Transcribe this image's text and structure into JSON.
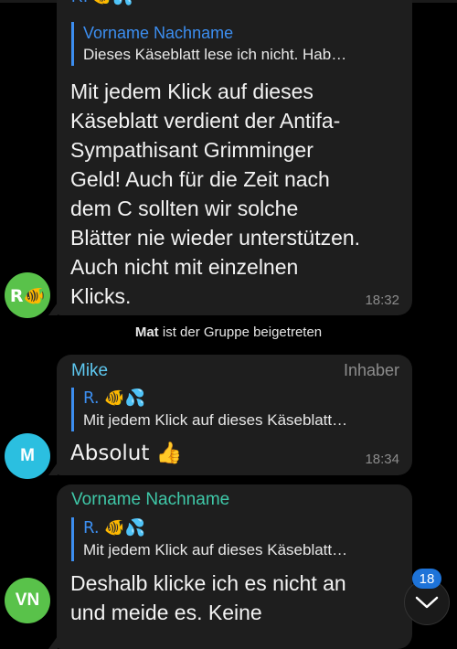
{
  "messages": [
    {
      "reply_name": "Vorname Nachname",
      "reply_text": "Dieses Käseblatt lese ich nicht. Hab…",
      "text_lines": [
        "Mit jedem Klick auf dieses",
        "Käseblatt verdient der Antifa-",
        "Sympathisant Grimminger",
        "Geld! Auch für die Zeit nach",
        "dem C sollten wir solche",
        "Blätter nie wieder unterstützen.",
        "Auch nicht mit einzelnen",
        "Klicks."
      ],
      "time": "18:32",
      "avatar_text": "R🐠",
      "avatar_color": "#59c24a"
    },
    {
      "sender": "Mike",
      "sender_color": "#5ec8f0",
      "role": "Inhaber",
      "reply_name": "R. 🐠💦",
      "reply_text": "Mit jedem Klick auf dieses Käseblatt…",
      "text": "Absolut 👍",
      "time": "18:34",
      "avatar_text": "M",
      "avatar_color": "#2bbfe0"
    },
    {
      "sender": "Vorname Nachname",
      "sender_color": "#3fc8a8",
      "reply_name": "R. 🐠💦",
      "reply_text": "Mit jedem Klick auf dieses Käseblatt…",
      "text_lines": [
        "Deshalb klicke ich es nicht an",
        "und meide es. Keine"
      ],
      "avatar_text": "VN",
      "avatar_color": "#59c24a"
    }
  ],
  "service": {
    "name": "Mat",
    "text": "ist der Gruppe beigetreten"
  },
  "top_fragment": "R. 🐠💦",
  "scroll": {
    "unread_count": "18",
    "icon": "chevron-down-icon"
  }
}
